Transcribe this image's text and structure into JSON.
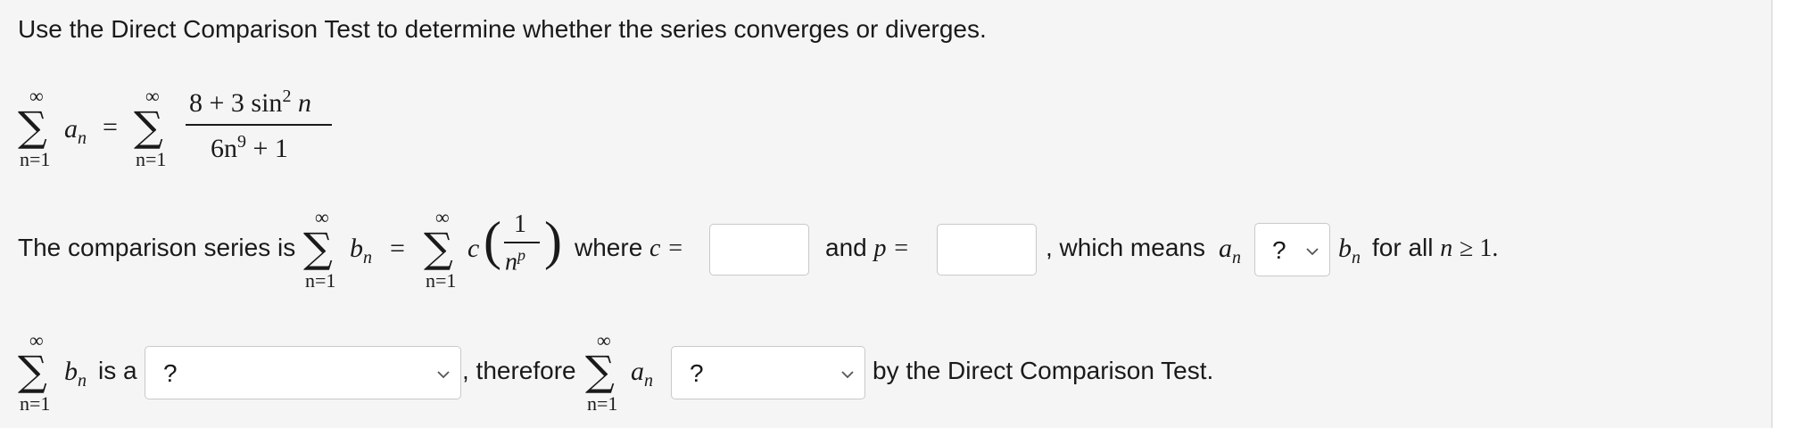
{
  "prompt": "Use the Direct Comparison Test to determine whether the series converges or diverges.",
  "series_def": {
    "inf": "∞",
    "lower_limit": "n=1",
    "lhs_term": "a",
    "lhs_sub": "n",
    "equals": "=",
    "numerator": "8 + 3 sin",
    "numerator_sup": "2",
    "numerator_var": "n",
    "denominator": "6n",
    "denominator_sup": "9",
    "denominator_tail": " + 1"
  },
  "comparison": {
    "lead_text": "The comparison series is",
    "b_term": "b",
    "b_sub": "n",
    "equals": "=",
    "c_var": "c",
    "frac_num": "1",
    "frac_den": "n",
    "frac_den_sup": "p",
    "where_text": "where",
    "c_label": "c =",
    "and_text": "and",
    "p_label": "p =",
    "which_means": ", which means",
    "a_term": "a",
    "a_sub": "n",
    "relation_value": "?",
    "b_after": "b",
    "b_after_sub": "n",
    "for_all": "for all",
    "n_var": "n",
    "geq": "≥ 1."
  },
  "conclusion": {
    "b_term": "b",
    "b_sub": "n",
    "is_a": "is a",
    "series_type_value": "?",
    "therefore": ", therefore",
    "a_term": "a",
    "a_sub": "n",
    "result_value": "?",
    "tail": "by the Direct Comparison Test."
  }
}
